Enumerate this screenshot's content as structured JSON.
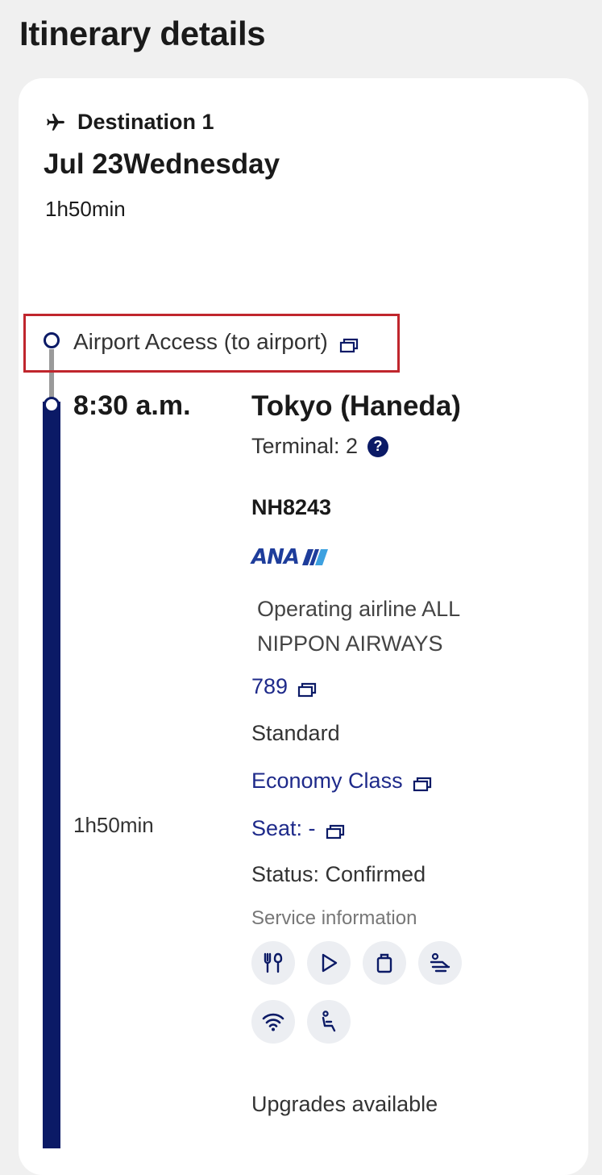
{
  "page": {
    "title": "Itinerary details"
  },
  "destination": {
    "label": "Destination 1",
    "date": "Jul 23Wednesday",
    "duration": "1h50min"
  },
  "airport_access": {
    "label": "Airport Access (to airport)"
  },
  "segment": {
    "departure_time": "8:30 a.m.",
    "city": "Tokyo (Haneda)",
    "terminal": "Terminal: 2",
    "help_glyph": "?",
    "flight_number": "NH8243",
    "airline_logo_text": "ANA",
    "operating_airline": "Operating airline ALL NIPPON AIRWAYS",
    "aircraft": "789",
    "fare_type": "Standard",
    "cabin_class": "Economy Class",
    "seat": "Seat: -",
    "flight_duration": "1h50min",
    "status": "Status: Confirmed",
    "service_label": "Service information",
    "services": [
      "meal-icon",
      "entertainment-icon",
      "baggage-icon",
      "lounge-icon",
      "wifi-icon",
      "seat-icon"
    ],
    "upgrades": "Upgrades available"
  },
  "colors": {
    "navy": "#0b1a66",
    "link": "#1e2a8a",
    "highlight": "#c0262d",
    "ana_blue": "#1e3d9b"
  }
}
